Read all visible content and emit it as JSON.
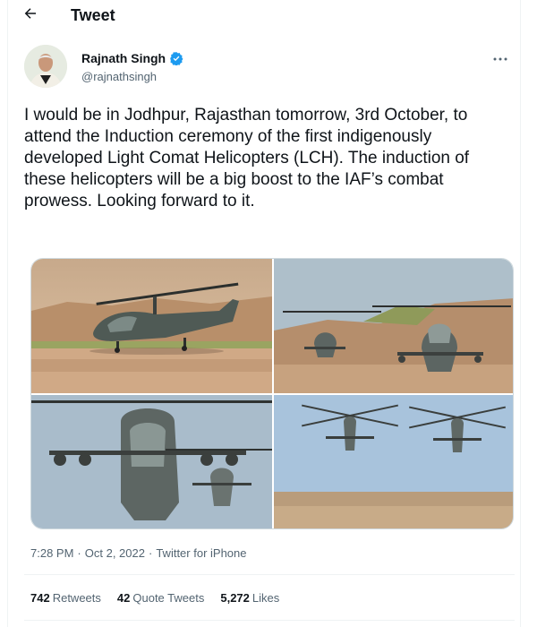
{
  "header": {
    "title": "Tweet"
  },
  "author": {
    "name": "Rajnath Singh",
    "handle": "@rajnathsingh",
    "verified": true
  },
  "tweet": {
    "text": "I would be in Jodhpur, Rajasthan tomorrow, 3rd October, to attend the Induction ceremony of the first indigenously developed Light Comat Helicopters (LCH). The induction of these helicopters will be a big boost to the IAF’s combat prowess. Looking forward to it.",
    "time": "7:28 PM",
    "date": "Oct 2, 2022",
    "source": "Twitter for iPhone",
    "separator": "·"
  },
  "stats": {
    "retweets": {
      "count": "742",
      "label": "Retweets"
    },
    "quotes": {
      "count": "42",
      "label": "Quote Tweets"
    },
    "likes": {
      "count": "5,272",
      "label": "Likes"
    }
  },
  "icons": {
    "back": "arrow-left-icon",
    "verified": "verified-badge-icon",
    "more": "more-icon"
  },
  "colors": {
    "accent": "#1d9bf0",
    "text": "#0f1419",
    "secondary": "#536471",
    "border": "#eff3f4"
  }
}
